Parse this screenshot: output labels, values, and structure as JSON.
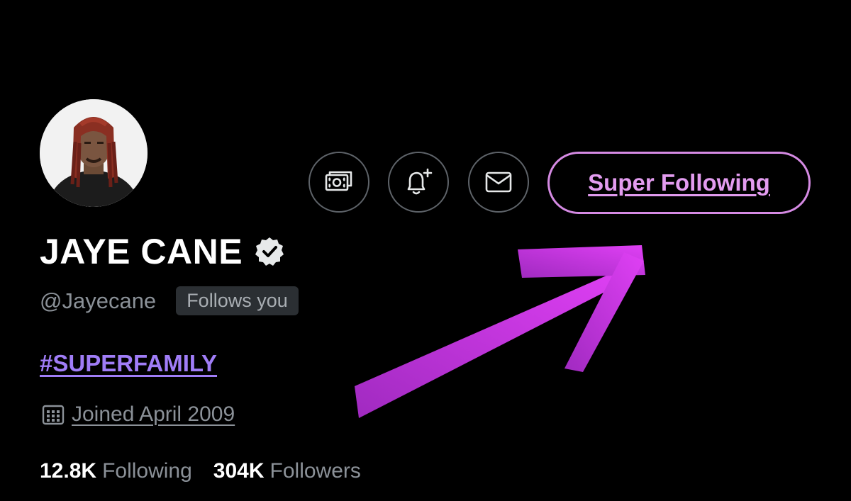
{
  "profile": {
    "name": "JAYE CANE",
    "handle": "@Jayecane",
    "follows_you": "Follows you",
    "bio_hashtag": "#SUPERFAMILY",
    "joined": "Joined April 2009",
    "following_count": "12.8K",
    "following_label": "Following",
    "followers_count": "304K",
    "followers_label": "Followers",
    "verified": true
  },
  "actions": {
    "tip_icon": "money-icon",
    "notify_icon": "bell-plus-icon",
    "message_icon": "mail-icon",
    "super_follow_label": "Super Following"
  },
  "colors": {
    "background": "#000000",
    "super_follow": "#e39cf0",
    "hashtag": "#a07df7",
    "annotation_arrow": "#d93cf0"
  }
}
